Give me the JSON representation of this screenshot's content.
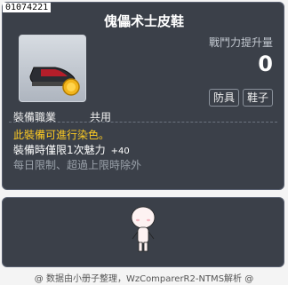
{
  "item": {
    "id": "01074221",
    "name": "傀儡术士皮鞋",
    "combat_power_label": "戰鬥力提升量",
    "combat_power_value": "0",
    "tags": [
      "防具",
      "鞋子"
    ],
    "job_label": "裝備職業",
    "job_value": "共用",
    "lines": {
      "dyeable": "此裝備可進行染色。",
      "stat_prefix": "裝備時僅限1次魅力",
      "stat_bonus": "+40",
      "limit": "每日限制、超過上限時除外"
    }
  },
  "footer": {
    "credit": "@ 数据由小册子整理，WzComparerR2-NTMS解析 @"
  },
  "icons": {
    "item_icon": "shoe-icon",
    "medal_icon": "gold-medal-icon",
    "character_icon": "character-preview"
  },
  "colors": {
    "panel_bg": "#3b4049",
    "accent_yellow": "#ffcc22",
    "muted_text": "#9aa1aa"
  }
}
